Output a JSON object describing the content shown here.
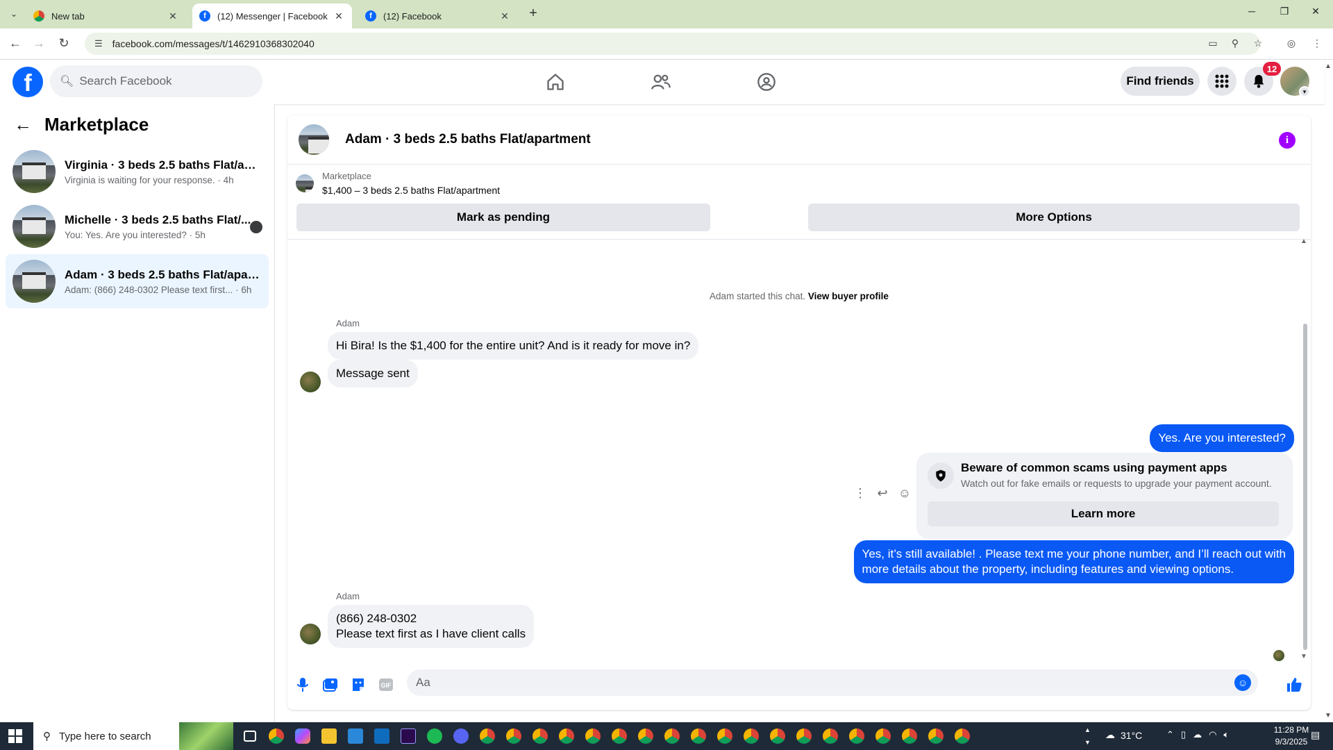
{
  "browser": {
    "tabs": [
      {
        "label": "New tab",
        "favicon": "chrome-icon",
        "active": false
      },
      {
        "label": "(12) Messenger | Facebook",
        "favicon": "facebook-icon",
        "active": true
      },
      {
        "label": "(12) Facebook",
        "favicon": "facebook-icon",
        "active": false
      }
    ],
    "url": "facebook.com/messages/t/1462910368302040"
  },
  "fb_header": {
    "search_placeholder": "Search Facebook",
    "find_friends_label": "Find friends",
    "notification_count": "12"
  },
  "sidebar": {
    "title": "Marketplace",
    "conversations": [
      {
        "name": "Virginia · 3 beds 2.5 baths Flat/apa...",
        "preview": "Virginia is waiting for your response. · 4h",
        "unread": false,
        "active": false
      },
      {
        "name": "Michelle · 3 beds 2.5 baths Flat/...",
        "preview": "You: Yes. Are you interested? · 5h",
        "unread": true,
        "active": false
      },
      {
        "name": "Adam · 3 beds 2.5 baths Flat/apart...",
        "preview": "Adam: (866) 248-0302 Please text first... · 6h",
        "unread": false,
        "active": true
      }
    ]
  },
  "chat": {
    "title": "Adam · 3 beds 2.5 baths Flat/apartment",
    "listing_category": "Marketplace",
    "listing_title": "$1,400 – 3 beds 2.5 baths Flat/apartment",
    "mark_pending_label": "Mark as pending",
    "more_options_label": "More Options",
    "system_text": "Adam started this chat.",
    "system_link": "View buyer profile",
    "messages": {
      "sender1": "Adam",
      "in1": "Hi Bira! Is the $1,400 for the entire unit? And is it ready for move in?",
      "in2": "Message sent",
      "out1": "Yes. Are you interested?",
      "warning_title": "Beware of common scams using payment apps",
      "warning_sub": "Watch out for fake emails or requests to upgrade your payment account.",
      "learn_more": "Learn more",
      "out2_line1": "Yes, it’s still available! . Please text me your phone number, and I’ll reach out with",
      "out2_line2": "more details about the property, including features and viewing options.",
      "sender2": "Adam",
      "in3_line1": "(866) 248-0302",
      "in3_line2": "Please text first as I have client calls"
    },
    "composer_placeholder": "Aa"
  },
  "taskbar": {
    "search_placeholder": "Type here to search",
    "temperature": "31°C",
    "time": "11:28 PM",
    "date": "9/3/2025"
  },
  "colors": {
    "fb_blue": "#0866ff",
    "outgoing_bubble": "#0a59f5",
    "active_conversation": "#ebf5ff",
    "tabstrip": "#d3e3c4",
    "notification_red": "#e41e3f",
    "info_purple": "#a100ff"
  }
}
